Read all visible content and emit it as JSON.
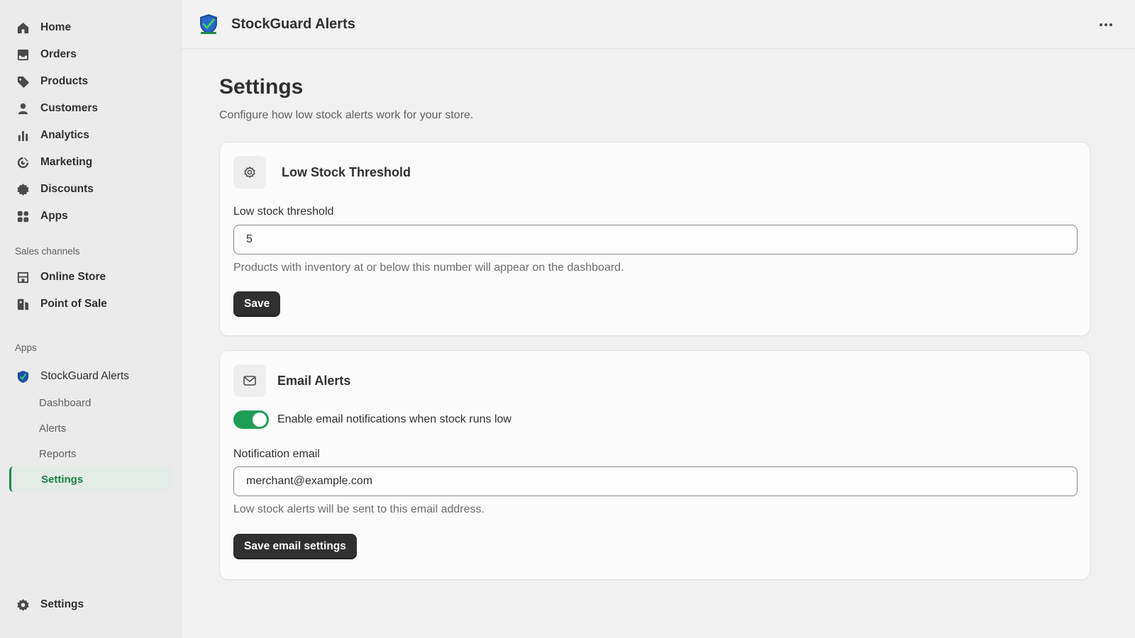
{
  "sidebar": {
    "nav": [
      {
        "label": "Home",
        "icon": "home-icon"
      },
      {
        "label": "Orders",
        "icon": "inbox-icon"
      },
      {
        "label": "Products",
        "icon": "tag-icon"
      },
      {
        "label": "Customers",
        "icon": "person-icon"
      },
      {
        "label": "Analytics",
        "icon": "bar-chart-icon"
      },
      {
        "label": "Marketing",
        "icon": "target-icon"
      },
      {
        "label": "Discounts",
        "icon": "discount-icon"
      },
      {
        "label": "Apps",
        "icon": "apps-grid-icon"
      }
    ],
    "sales_channels_label": "Sales channels",
    "sales_channels": [
      {
        "label": "Online Store",
        "icon": "store-icon"
      },
      {
        "label": "Point of Sale",
        "icon": "pos-icon"
      }
    ],
    "apps_label": "Apps",
    "app": {
      "label": "StockGuard Alerts",
      "icon": "stockguard-shield-icon"
    },
    "app_pages": [
      {
        "label": "Dashboard",
        "active": false
      },
      {
        "label": "Alerts",
        "active": false
      },
      {
        "label": "Reports",
        "active": false
      },
      {
        "label": "Settings",
        "active": true
      }
    ],
    "settings_label": "Settings"
  },
  "topbar": {
    "title": "StockGuard Alerts",
    "more_icon": "more-horizontal-icon"
  },
  "page": {
    "title": "Settings",
    "subtitle": "Configure how low stock alerts work for your store."
  },
  "threshold_card": {
    "icon": "gear-icon",
    "title": "Low Stock Threshold",
    "field_label": "Low stock threshold",
    "value": "5",
    "help": "Products with inventory at or below this number will appear on the dashboard.",
    "save_label": "Save"
  },
  "email_card": {
    "icon": "envelope-icon",
    "title": "Email Alerts",
    "toggle_on": true,
    "toggle_label": "Enable email notifications when stock runs low",
    "field_label": "Notification email",
    "value": "merchant@example.com",
    "help": "Low stock alerts will be sent to this email address.",
    "save_label": "Save email settings"
  },
  "colors": {
    "accent_green": "#1f9d55",
    "active_nav_text": "#1a7f44",
    "button_dark": "#303030"
  }
}
